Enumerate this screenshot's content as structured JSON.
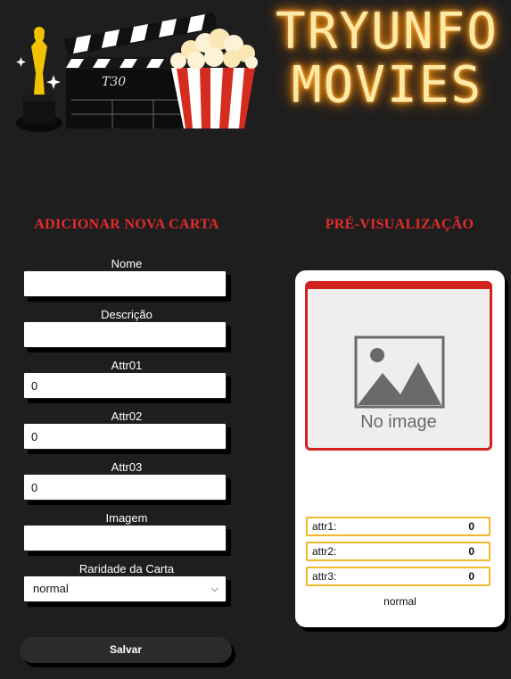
{
  "header": {
    "brand_line1": "TRYUNFO",
    "brand_line2": "MOVIES",
    "clapper_text": "T30"
  },
  "form": {
    "title": "ADICIONAR NOVA CARTA",
    "fields": [
      {
        "label": "Nome",
        "value": ""
      },
      {
        "label": "Descrição",
        "value": ""
      },
      {
        "label": "Attr01",
        "value": "0"
      },
      {
        "label": "Attr02",
        "value": "0"
      },
      {
        "label": "Attr03",
        "value": "0"
      },
      {
        "label": "Imagem",
        "value": ""
      }
    ],
    "rarity_label": "Raridade da Carta",
    "rarity_selected": "normal",
    "save_label": "Salvar"
  },
  "preview": {
    "title": "PRÉ-VISUALIZAÇÃO",
    "no_image_text": "No image",
    "attrs": [
      {
        "label": "attr1:",
        "value": "0"
      },
      {
        "label": "attr2:",
        "value": "0"
      },
      {
        "label": "attr3:",
        "value": "0"
      }
    ],
    "rarity": "normal"
  },
  "colors": {
    "background": "#1e1e1e",
    "accent_red": "#e32b2b",
    "neon_gold": "#ffe9a6",
    "attr_border": "#f0b82a"
  }
}
